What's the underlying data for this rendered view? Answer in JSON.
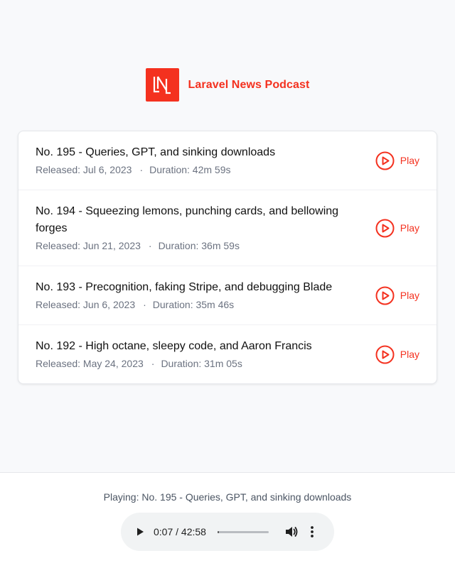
{
  "brand": {
    "name": "Laravel News Podcast",
    "color": "#f4311f",
    "logo_text": "LN"
  },
  "episodes": [
    {
      "title": "No. 195 - Queries, GPT, and sinking downloads",
      "released": "Released: Jul 6, 2023",
      "separator": "·",
      "duration": "Duration: 42m 59s",
      "play_label": "Play"
    },
    {
      "title": "No. 194 - Squeezing lemons, punching cards, and bellowing forges",
      "released": "Released: Jun 21, 2023",
      "separator": "·",
      "duration": "Duration: 36m 59s",
      "play_label": "Play"
    },
    {
      "title": "No. 193 - Precognition, faking Stripe, and debugging Blade",
      "released": "Released: Jun 6, 2023",
      "separator": "·",
      "duration": "Duration: 35m 46s",
      "play_label": "Play"
    },
    {
      "title": "No. 192 - High octane, sleepy code, and Aaron Francis",
      "released": "Released: May 24, 2023",
      "separator": "·",
      "duration": "Duration: 31m 05s",
      "play_label": "Play"
    }
  ],
  "player": {
    "now_playing": "Playing: No. 195 - Queries, GPT, and sinking downloads",
    "time": "0:07 / 42:58",
    "progress_fraction": 0.003,
    "icons": [
      "play-icon",
      "volume-icon",
      "more-options-icon"
    ]
  }
}
